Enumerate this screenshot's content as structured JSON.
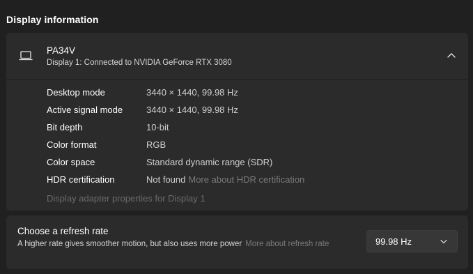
{
  "section_title": "Display information",
  "display": {
    "name": "PA34V",
    "subtitle": "Display 1: Connected to NVIDIA GeForce RTX 3080",
    "icon": "laptop-monitor-icon",
    "expanded": true,
    "rows": [
      {
        "label": "Desktop mode",
        "value": "3440 × 1440, 99.98 Hz"
      },
      {
        "label": "Active signal mode",
        "value": "3440 × 1440, 99.98 Hz"
      },
      {
        "label": "Bit depth",
        "value": "10-bit"
      },
      {
        "label": "Color format",
        "value": "RGB"
      },
      {
        "label": "Color space",
        "value": "Standard dynamic range (SDR)"
      },
      {
        "label": "HDR certification",
        "value": "Not found",
        "link": "More about HDR certification"
      }
    ],
    "adapter_link": "Display adapter properties for Display 1"
  },
  "refresh": {
    "title": "Choose a refresh rate",
    "description": "A higher rate gives smoother motion, but also uses more power",
    "more_link": "More about refresh rate",
    "selected": "99.98 Hz"
  },
  "colors": {
    "background": "#202020",
    "card": "#2b2b2b",
    "link_muted": "#7a7a7a",
    "select_bg": "#373737"
  }
}
